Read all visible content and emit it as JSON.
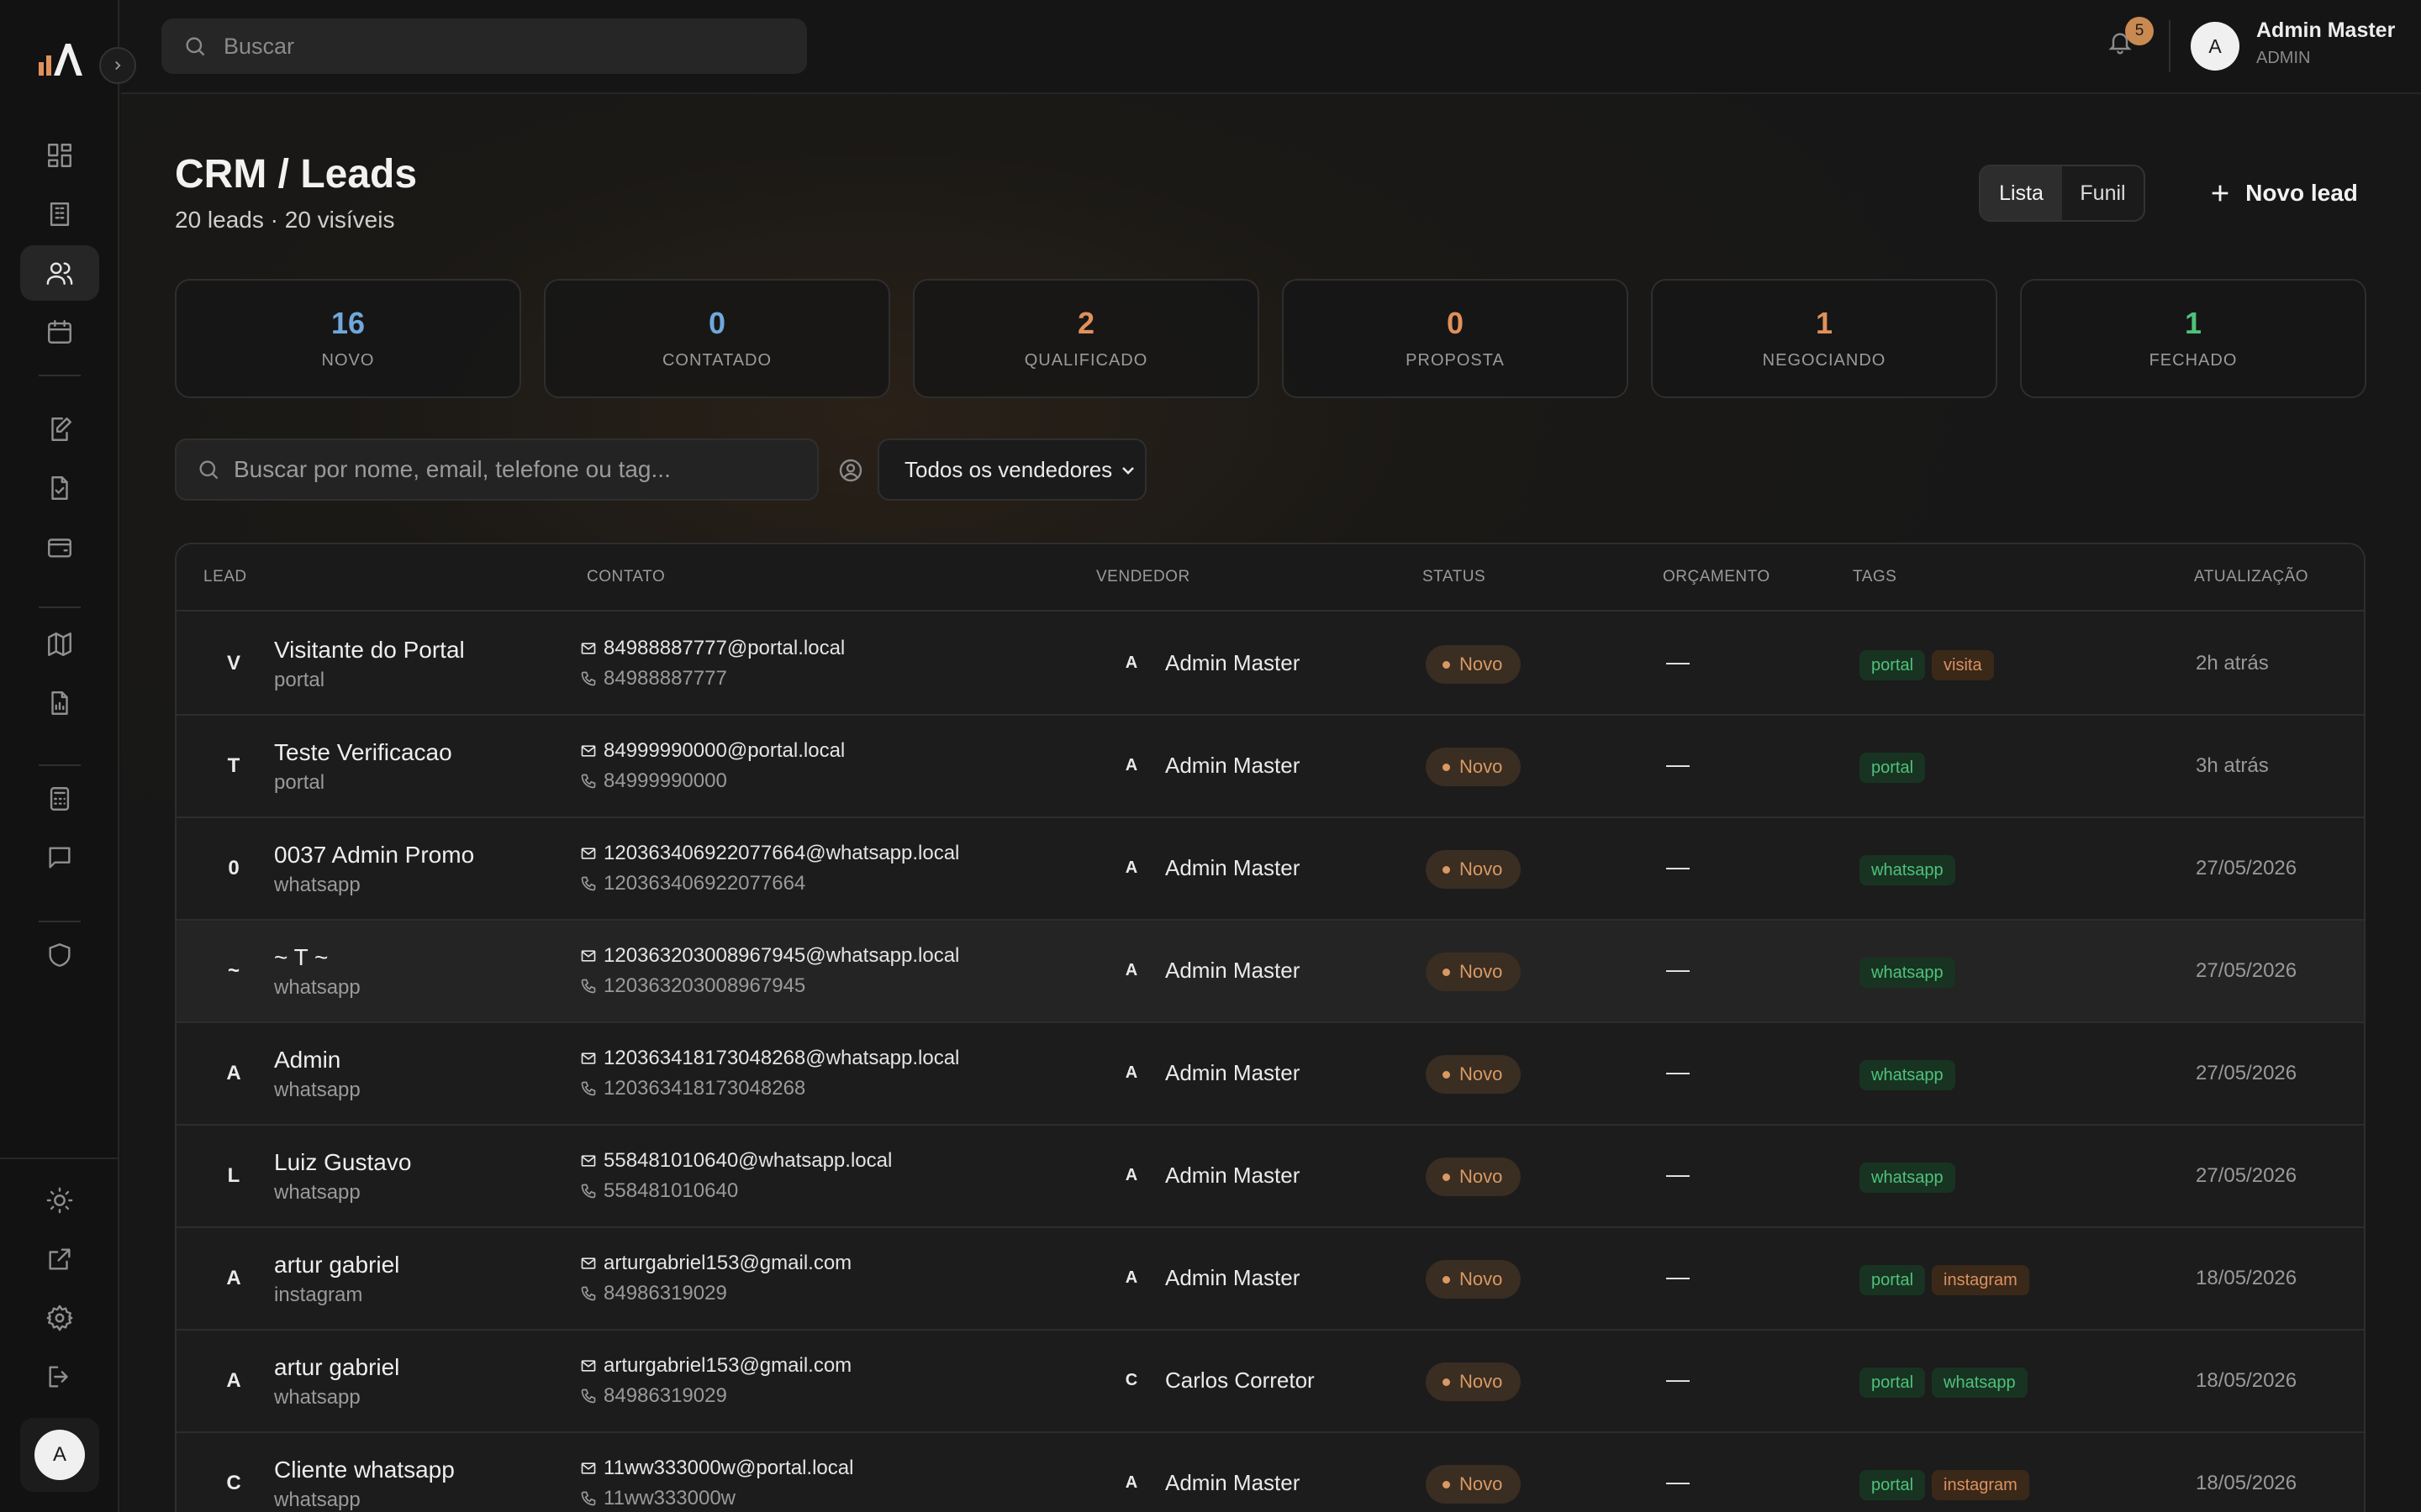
{
  "topbar": {
    "search_placeholder": "Buscar",
    "notifications_count": "5",
    "user": {
      "initial": "A",
      "name": "Admin Master",
      "role": "ADMIN"
    }
  },
  "sidebar": {
    "avatar_initial": "A",
    "nav": [
      "dashboard-icon",
      "building-icon",
      "users-icon",
      "calendar-icon",
      "edit-document-icon",
      "file-check-icon",
      "wallet-icon",
      "map-icon",
      "report-icon",
      "calculator-icon",
      "chat-icon",
      "shield-icon"
    ],
    "bottom": [
      "sun-icon",
      "external-link-icon",
      "settings-icon",
      "logout-icon"
    ]
  },
  "page": {
    "title": "CRM / Leads",
    "subtitle": "20 leads · 20 visíveis",
    "view_list": "Lista",
    "view_funnel": "Funil",
    "new_lead": "Novo lead"
  },
  "stats": [
    {
      "value": "16",
      "label": "NOVO",
      "color": "#6fa8dc"
    },
    {
      "value": "0",
      "label": "CONTATADO",
      "color": "#6fa8dc"
    },
    {
      "value": "2",
      "label": "QUALIFICADO",
      "color": "#e0915a"
    },
    {
      "value": "0",
      "label": "PROPOSTA",
      "color": "#e0915a"
    },
    {
      "value": "1",
      "label": "NEGOCIANDO",
      "color": "#e0915a"
    },
    {
      "value": "1",
      "label": "FECHADO",
      "color": "#4fc27a"
    }
  ],
  "filters": {
    "search_placeholder": "Buscar por nome, email, telefone ou tag...",
    "vendor": "Todos os vendedores"
  },
  "table": {
    "headers": [
      "LEAD",
      "CONTATO",
      "VENDEDOR",
      "STATUS",
      "ORÇAMENTO",
      "TAGS",
      "ATUALIZAÇÃO"
    ],
    "rows": [
      {
        "initial": "V",
        "name": "Visitante do Portal",
        "source": "portal",
        "email": "84988887777@portal.local",
        "phone": "84988887777",
        "vendor_initial": "A",
        "vendor": "Admin Master",
        "status": "Novo",
        "budget": "—",
        "tags": [
          {
            "t": "portal",
            "c": "green"
          },
          {
            "t": "visita",
            "c": "orange"
          }
        ],
        "updated": "2h atrás"
      },
      {
        "initial": "T",
        "name": "Teste Verificacao",
        "source": "portal",
        "email": "84999990000@portal.local",
        "phone": "84999990000",
        "vendor_initial": "A",
        "vendor": "Admin Master",
        "status": "Novo",
        "budget": "—",
        "tags": [
          {
            "t": "portal",
            "c": "green"
          }
        ],
        "updated": "3h atrás"
      },
      {
        "initial": "0",
        "name": "0037 Admin Promo",
        "source": "whatsapp",
        "email": "120363406922077664@whatsapp.local",
        "phone": "120363406922077664",
        "vendor_initial": "A",
        "vendor": "Admin Master",
        "status": "Novo",
        "budget": "—",
        "tags": [
          {
            "t": "whatsapp",
            "c": "green"
          }
        ],
        "updated": "27/05/2026"
      },
      {
        "initial": "~",
        "name": "~ T ~",
        "source": "whatsapp",
        "email": "120363203008967945@whatsapp.local",
        "phone": "120363203008967945",
        "vendor_initial": "A",
        "vendor": "Admin Master",
        "status": "Novo",
        "budget": "—",
        "tags": [
          {
            "t": "whatsapp",
            "c": "green"
          }
        ],
        "updated": "27/05/2026"
      },
      {
        "initial": "A",
        "name": "Admin",
        "source": "whatsapp",
        "email": "120363418173048268@whatsapp.local",
        "phone": "120363418173048268",
        "vendor_initial": "A",
        "vendor": "Admin Master",
        "status": "Novo",
        "budget": "—",
        "tags": [
          {
            "t": "whatsapp",
            "c": "green"
          }
        ],
        "updated": "27/05/2026"
      },
      {
        "initial": "L",
        "name": "Luiz Gustavo",
        "source": "whatsapp",
        "email": "558481010640@whatsapp.local",
        "phone": "558481010640",
        "vendor_initial": "A",
        "vendor": "Admin Master",
        "status": "Novo",
        "budget": "—",
        "tags": [
          {
            "t": "whatsapp",
            "c": "green"
          }
        ],
        "updated": "27/05/2026"
      },
      {
        "initial": "A",
        "name": "artur gabriel",
        "source": "instagram",
        "email": "arturgabriel153@gmail.com",
        "phone": "84986319029",
        "vendor_initial": "A",
        "vendor": "Admin Master",
        "status": "Novo",
        "budget": "—",
        "tags": [
          {
            "t": "portal",
            "c": "green"
          },
          {
            "t": "instagram",
            "c": "orange"
          }
        ],
        "updated": "18/05/2026"
      },
      {
        "initial": "A",
        "name": "artur gabriel",
        "source": "whatsapp",
        "email": "arturgabriel153@gmail.com",
        "phone": "84986319029",
        "vendor_initial": "C",
        "vendor": "Carlos Corretor",
        "status": "Novo",
        "budget": "—",
        "tags": [
          {
            "t": "portal",
            "c": "green"
          },
          {
            "t": "whatsapp",
            "c": "green"
          }
        ],
        "updated": "18/05/2026"
      },
      {
        "initial": "C",
        "name": "Cliente whatsapp",
        "source": "whatsapp",
        "email": "11ww333000w@portal.local",
        "phone": "11ww333000w",
        "vendor_initial": "A",
        "vendor": "Admin Master",
        "status": "Novo",
        "budget": "—",
        "tags": [
          {
            "t": "portal",
            "c": "green"
          },
          {
            "t": "instagram",
            "c": "orange"
          }
        ],
        "updated": "18/05/2026"
      }
    ]
  }
}
